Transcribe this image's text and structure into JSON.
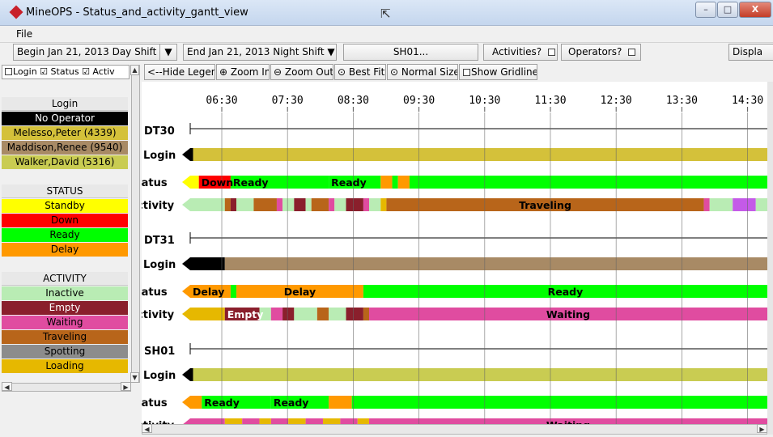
{
  "window": {
    "title": "MineOPS - Status_and_activity_gantt_view"
  },
  "menu": {
    "file": "File"
  },
  "toolbar": {
    "begin_label": "Begin",
    "begin_date": "Jan 21, 2013",
    "begin_shift": "Day Shift",
    "end_label": "End",
    "end_date": "Jan 21, 2013",
    "end_shift": "Night Shift",
    "equipment": "SH01...",
    "activities_label": "Activities?",
    "operators_label": "Operators?",
    "display_label": "Displa"
  },
  "left_panel": {
    "filter_text": "Login ☑ Status ☑ Activ"
  },
  "legend": {
    "login_header": "Login",
    "login_items": [
      {
        "label": "No Operator",
        "color": "#000000",
        "text_color": "#ffffff"
      },
      {
        "label": "Melesso,Peter (4339)",
        "color": "#d4c13a",
        "text_color": "#000000"
      },
      {
        "label": "Maddison,Renee (9540)",
        "color": "#a88a65",
        "text_color": "#000000"
      },
      {
        "label": "Walker,David (5316)",
        "color": "#c9cc52",
        "text_color": "#000000"
      }
    ],
    "status_header": "STATUS",
    "status_items": [
      {
        "label": "Standby",
        "color": "#ffff00",
        "text_color": "#000000"
      },
      {
        "label": "Down",
        "color": "#ff0000",
        "text_color": "#000000"
      },
      {
        "label": "Ready",
        "color": "#00ff00",
        "text_color": "#000000"
      },
      {
        "label": "Delay",
        "color": "#ff9900",
        "text_color": "#000000"
      }
    ],
    "activity_header": "ACTIVITY",
    "activity_items": [
      {
        "label": "Inactive",
        "color": "#b9ecb4",
        "text_color": "#000000"
      },
      {
        "label": "Empty",
        "color": "#8a1f2c",
        "text_color": "#ffffff"
      },
      {
        "label": "Waiting",
        "color": "#e04ca0",
        "text_color": "#000000"
      },
      {
        "label": "Traveling",
        "color": "#b8651a",
        "text_color": "#000000"
      },
      {
        "label": "Spotting",
        "color": "#8c8c8c",
        "text_color": "#000000"
      },
      {
        "label": "Loading",
        "color": "#e6b800",
        "text_color": "#000000"
      }
    ]
  },
  "gantt_toolbar": {
    "hide_legend": "<--Hide Legend",
    "zoom_in": "Zoom In",
    "zoom_out": "Zoom Out",
    "best_fit": "Best Fit",
    "normal_size": "Normal Size",
    "show_gridlines": "Show Gridlines"
  },
  "gantt": {
    "time_labels": [
      "06:30",
      "07:30",
      "08:30",
      "09:30",
      "10:30",
      "11:30",
      "12:30",
      "13:30",
      "14:30"
    ],
    "gridlines": true,
    "units": [
      {
        "name": "DT30",
        "rows": [
          {
            "label": "Login",
            "segments": [
              {
                "color": "#000000",
                "start": 0,
                "end": 0.5
              },
              {
                "color": "#d4c13a",
                "start": 0.5,
                "end": 100
              }
            ]
          },
          {
            "label": "Status",
            "segments": [
              {
                "color": "#ffff00",
                "start": 0,
                "end": 1.5
              },
              {
                "color": "#ff0000",
                "start": 1.5,
                "end": 7,
                "text": "Down"
              },
              {
                "color": "#00ff00",
                "start": 7,
                "end": 24,
                "text": "Ready"
              },
              {
                "color": "#00ff00",
                "start": 24,
                "end": 33,
                "text": "Ready"
              },
              {
                "color": "#ff9900",
                "start": 33,
                "end": 35
              },
              {
                "color": "#00ff00",
                "start": 35,
                "end": 36
              },
              {
                "color": "#ff9900",
                "start": 36,
                "end": 38
              },
              {
                "color": "#00ff00",
                "start": 38,
                "end": 100
              }
            ]
          },
          {
            "label": "Activity",
            "segments": [
              {
                "color": "#b9ecb4",
                "start": 0,
                "end": 6
              },
              {
                "color": "#b8651a",
                "start": 6,
                "end": 7
              },
              {
                "color": "#8a1f2c",
                "start": 7,
                "end": 8
              },
              {
                "color": "#b9ecb4",
                "start": 8,
                "end": 11
              },
              {
                "color": "#b8651a",
                "start": 11,
                "end": 15
              },
              {
                "color": "#e04ca0",
                "start": 15,
                "end": 16
              },
              {
                "color": "#b9ecb4",
                "start": 16,
                "end": 18
              },
              {
                "color": "#8a1f2c",
                "start": 18,
                "end": 20
              },
              {
                "color": "#b9ecb4",
                "start": 20,
                "end": 21
              },
              {
                "color": "#b8651a",
                "start": 21,
                "end": 24
              },
              {
                "color": "#e04ca0",
                "start": 24,
                "end": 25
              },
              {
                "color": "#b9ecb4",
                "start": 25,
                "end": 27
              },
              {
                "color": "#8a1f2c",
                "start": 27,
                "end": 30
              },
              {
                "color": "#e04ca0",
                "start": 30,
                "end": 31
              },
              {
                "color": "#b9ecb4",
                "start": 31,
                "end": 33
              },
              {
                "color": "#e6b800",
                "start": 33,
                "end": 34
              },
              {
                "color": "#b8651a",
                "start": 34,
                "end": 89,
                "text": "Traveling"
              },
              {
                "color": "#e04ca0",
                "start": 89,
                "end": 90
              },
              {
                "color": "#b9ecb4",
                "start": 90,
                "end": 94
              },
              {
                "color": "#c45ae8",
                "start": 94,
                "end": 98
              },
              {
                "color": "#b9ecb4",
                "start": 98,
                "end": 100
              }
            ]
          }
        ]
      },
      {
        "name": "DT31",
        "rows": [
          {
            "label": "Login",
            "segments": [
              {
                "color": "#000000",
                "start": 0,
                "end": 6
              },
              {
                "color": "#a88a65",
                "start": 6,
                "end": 100
              }
            ]
          },
          {
            "label": "Status",
            "segments": [
              {
                "color": "#ff9900",
                "start": 0,
                "end": 7,
                "text": "Delay"
              },
              {
                "color": "#00ff00",
                "start": 7,
                "end": 8
              },
              {
                "color": "#ff9900",
                "start": 8,
                "end": 30,
                "text": "Delay"
              },
              {
                "color": "#00ff00",
                "start": 30,
                "end": 100,
                "text": "Ready"
              }
            ]
          },
          {
            "label": "Activity",
            "segments": [
              {
                "color": "#e6b800",
                "start": 0,
                "end": 6
              },
              {
                "color": "#8a1f2c",
                "start": 6,
                "end": 12,
                "text": "Empty"
              },
              {
                "color": "#b9ecb4",
                "start": 12,
                "end": 14
              },
              {
                "color": "#e04ca0",
                "start": 14,
                "end": 16
              },
              {
                "color": "#8a1f2c",
                "start": 16,
                "end": 18
              },
              {
                "color": "#b9ecb4",
                "start": 18,
                "end": 22
              },
              {
                "color": "#b8651a",
                "start": 22,
                "end": 24
              },
              {
                "color": "#b9ecb4",
                "start": 24,
                "end": 27
              },
              {
                "color": "#8a1f2c",
                "start": 27,
                "end": 30
              },
              {
                "color": "#b8651a",
                "start": 30,
                "end": 31
              },
              {
                "color": "#e04ca0",
                "start": 31,
                "end": 100,
                "text": "Waiting"
              }
            ]
          }
        ]
      },
      {
        "name": "SH01",
        "rows": [
          {
            "label": "Login",
            "segments": [
              {
                "color": "#000000",
                "start": 0,
                "end": 0.5
              },
              {
                "color": "#c9cc52",
                "start": 0.5,
                "end": 100
              }
            ]
          },
          {
            "label": "Status",
            "segments": [
              {
                "color": "#ff9900",
                "start": 0,
                "end": 2
              },
              {
                "color": "#00ff00",
                "start": 2,
                "end": 14,
                "text": "Ready"
              },
              {
                "color": "#00ff00",
                "start": 14,
                "end": 24,
                "text": "Ready"
              },
              {
                "color": "#ff9900",
                "start": 24,
                "end": 28
              },
              {
                "color": "#00ff00",
                "start": 28,
                "end": 100
              }
            ]
          },
          {
            "label": "Activity",
            "segments": [
              {
                "color": "#e04ca0",
                "start": 0,
                "end": 6
              },
              {
                "color": "#e6b800",
                "start": 6,
                "end": 9
              },
              {
                "color": "#e04ca0",
                "start": 9,
                "end": 12
              },
              {
                "color": "#e6b800",
                "start": 12,
                "end": 14
              },
              {
                "color": "#e04ca0",
                "start": 14,
                "end": 17
              },
              {
                "color": "#e6b800",
                "start": 17,
                "end": 20
              },
              {
                "color": "#e04ca0",
                "start": 20,
                "end": 23
              },
              {
                "color": "#e6b800",
                "start": 23,
                "end": 26
              },
              {
                "color": "#e04ca0",
                "start": 26,
                "end": 29
              },
              {
                "color": "#e6b800",
                "start": 29,
                "end": 31
              },
              {
                "color": "#e04ca0",
                "start": 31,
                "end": 100,
                "text": "Waiting"
              }
            ]
          }
        ]
      }
    ]
  }
}
